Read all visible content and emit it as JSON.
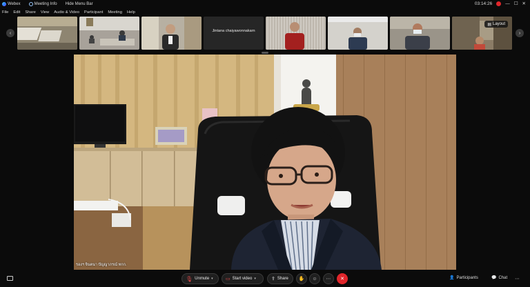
{
  "titlebar": {
    "app_name": "Webex",
    "meeting_info": "Meeting Info",
    "hide_menu_bar": "Hide Menu Bar",
    "time": "03:14:26"
  },
  "menu": [
    "File",
    "Edit",
    "Share",
    "View",
    "Audio & Video",
    "Participant",
    "Meeting",
    "Help"
  ],
  "filmstrip": {
    "text_tile_name": "Jintana chaiyawonnakarn",
    "layout_label": "Layout"
  },
  "main_video": {
    "name": "รองฯ จินตนา ปัญญาภรณ์ ทกก."
  },
  "controls": {
    "unmute": "Unmute",
    "start_video": "Start video",
    "share": "Share",
    "participants": "Participants",
    "chat": "Chat"
  },
  "colors": {
    "end_button": "#e0262b",
    "unmute_icon": "#e84b4b",
    "background": "#0b0b0b"
  }
}
